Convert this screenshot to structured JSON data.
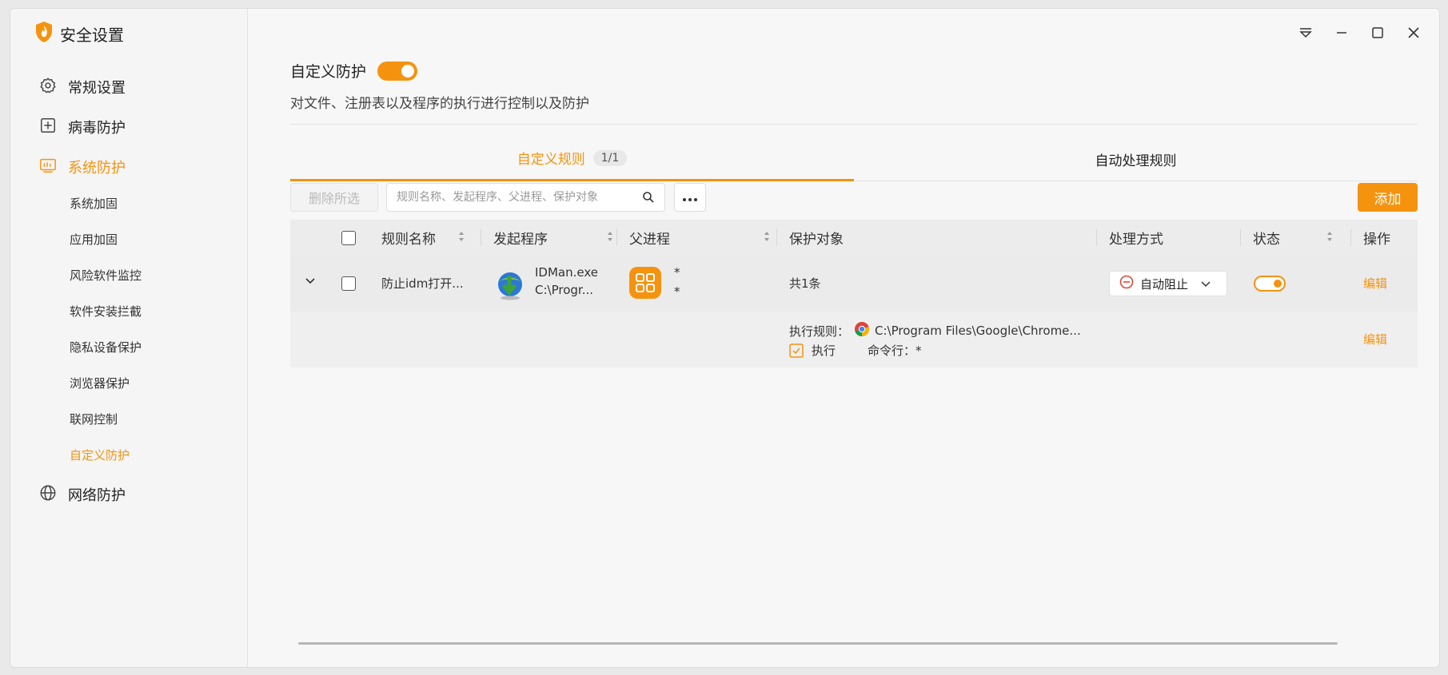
{
  "app": {
    "title": "安全设置",
    "accent": "#f5930f"
  },
  "sidebar": {
    "items": [
      {
        "label": "常规设置",
        "icon": "gear-icon"
      },
      {
        "label": "病毒防护",
        "icon": "plus-square-icon"
      },
      {
        "label": "系统防护",
        "icon": "system-icon",
        "active": true
      },
      {
        "label": "网络防护",
        "icon": "globe-icon"
      }
    ],
    "sub_items": [
      {
        "label": "系统加固"
      },
      {
        "label": "应用加固"
      },
      {
        "label": "风险软件监控"
      },
      {
        "label": "软件安装拦截"
      },
      {
        "label": "隐私设备保护"
      },
      {
        "label": "浏览器保护"
      },
      {
        "label": "联网控制"
      },
      {
        "label": "自定义防护",
        "active": true
      }
    ]
  },
  "header": {
    "title": "自定义防护",
    "toggle_on": true,
    "description": "对文件、注册表以及程序的执行进行控制以及防护"
  },
  "tabs": [
    {
      "label": "自定义规则",
      "count": "1/1",
      "active": true
    },
    {
      "label": "自动处理规则"
    }
  ],
  "toolbar": {
    "delete_label": "删除所选",
    "search_placeholder": "规则名称、发起程序、父进程、保护对象",
    "add_label": "添加"
  },
  "table": {
    "columns": [
      "规则名称",
      "发起程序",
      "父进程",
      "保护对象",
      "处理方式",
      "状态",
      "操作"
    ],
    "row": {
      "name": "防止idm打开...",
      "program_name": "IDMan.exe",
      "program_path": "C:\\Progr...",
      "parent_1": "*",
      "parent_2": "*",
      "protect_summary": "共1条",
      "action": "自动阻止",
      "status_on": true,
      "edit_label": "编辑"
    },
    "sub_row": {
      "rule_label": "执行规则：",
      "rule_path": "C:\\Program Files\\Google\\Chrome...",
      "exec_label": "执行",
      "cmd_label": "命令行：*",
      "edit_label": "编辑"
    }
  }
}
